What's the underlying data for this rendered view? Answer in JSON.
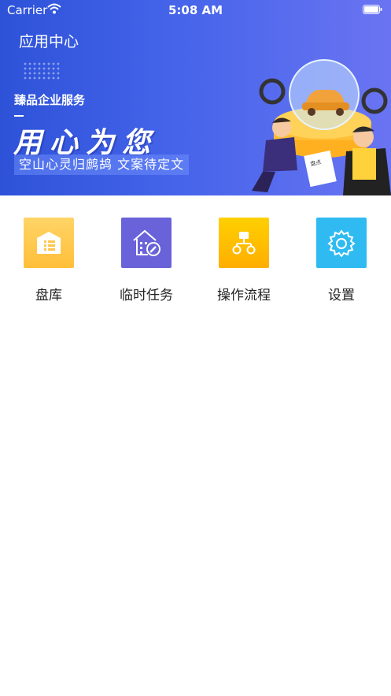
{
  "status_bar": {
    "carrier": "Carrier",
    "time": "5:08 AM"
  },
  "header": {
    "title": "应用中心"
  },
  "banner": {
    "company": "臻品企业服务",
    "slogan": "用心为您",
    "subline": "空山心灵归鹧鸪  文案待定文",
    "document_text": "盘点"
  },
  "menu": [
    {
      "label": "盘库",
      "icon": "warehouse-icon",
      "color": "#ffc74a"
    },
    {
      "label": "临时任务",
      "icon": "building-edit-icon",
      "color": "#6a62d8"
    },
    {
      "label": "操作流程",
      "icon": "flowchart-icon",
      "color": "#ffb400"
    },
    {
      "label": "设置",
      "icon": "gear-icon",
      "color": "#2fbaf2"
    }
  ]
}
